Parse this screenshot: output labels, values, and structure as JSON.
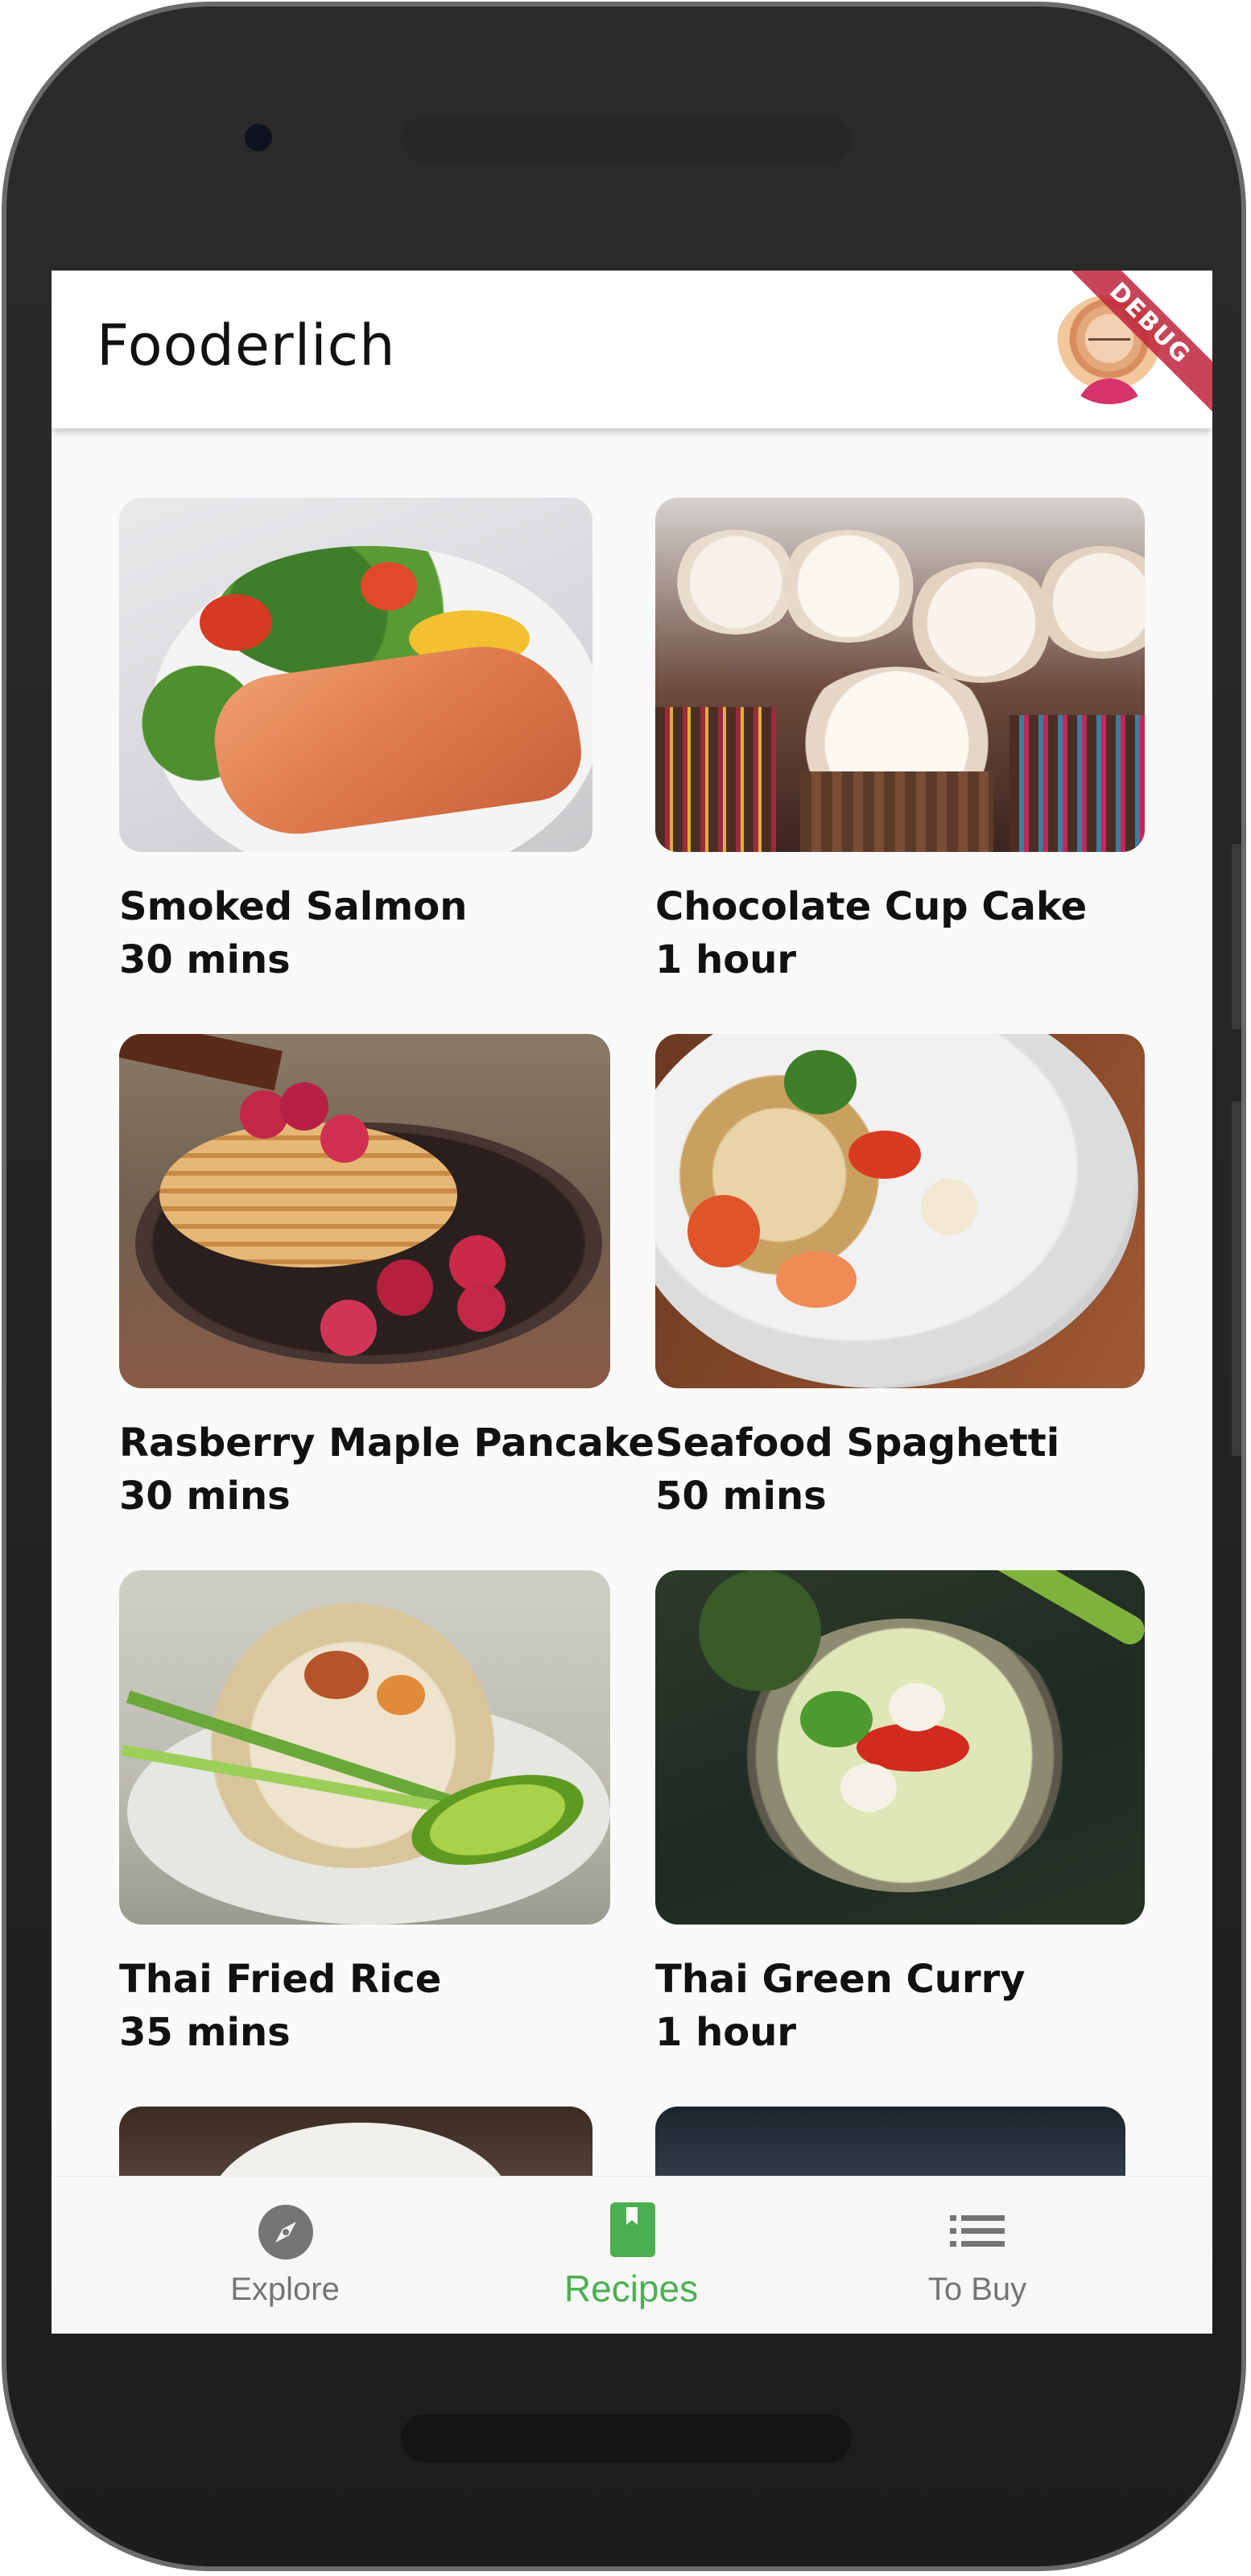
{
  "app": {
    "title": "Fooderlich",
    "debug_banner": "DEBUG"
  },
  "recipes": [
    {
      "name": "Smoked Salmon",
      "time": "30 mins"
    },
    {
      "name": "Chocolate Cup Cake",
      "time": "1 hour"
    },
    {
      "name": "Rasberry Maple Pancake",
      "time": "30 mins"
    },
    {
      "name": "Seafood Spaghetti",
      "time": "50 mins"
    },
    {
      "name": "Thai Fried Rice",
      "time": "35 mins"
    },
    {
      "name": "Thai Green Curry",
      "time": "1 hour"
    }
  ],
  "bottom_nav": {
    "items": [
      {
        "label": "Explore",
        "icon": "compass-icon"
      },
      {
        "label": "Recipes",
        "icon": "book-icon"
      },
      {
        "label": "To Buy",
        "icon": "list-icon"
      }
    ],
    "selected": "Recipes",
    "selected_color": "#4caf50",
    "unselected_color": "#757575"
  }
}
